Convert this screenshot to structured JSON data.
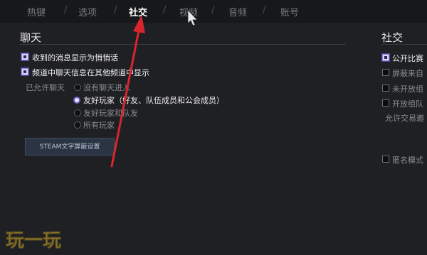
{
  "tabs": [
    "热键",
    "选项",
    "社交",
    "视频",
    "音频",
    "账号"
  ],
  "active_tab": "社交",
  "left": {
    "title": "聊天",
    "opt1": "收到的消息显示为悄悄话",
    "opt2": "频道中聊天信息在其他频道中显示",
    "allow_label": "已允许聊天",
    "radios": [
      "没有聊天进入",
      "友好玩家（好友、队伍成员和公会成员）",
      "友好玩家和队友",
      "所有玩家"
    ],
    "button": "STEAM文字屏蔽设置"
  },
  "right": {
    "title": "社交",
    "items": [
      "公开比赛",
      "屏蔽来自",
      "未开放组",
      "开放组队",
      "允许交易邀",
      "匿名模式"
    ]
  },
  "watermark": "玩一玩",
  "colors": {
    "accent": "#6b61c9",
    "arrow": "#d8262c"
  }
}
